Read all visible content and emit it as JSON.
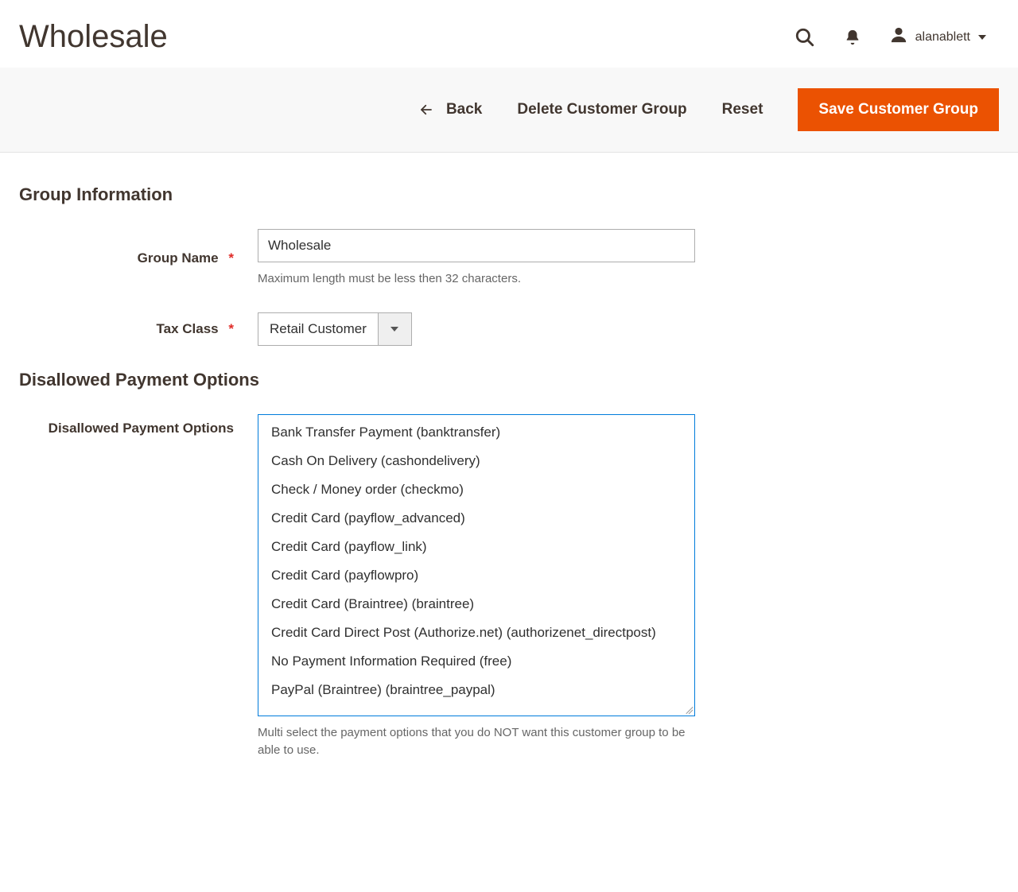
{
  "header": {
    "title": "Wholesale",
    "username": "alanablett"
  },
  "toolbar": {
    "back_label": "Back",
    "delete_label": "Delete Customer Group",
    "reset_label": "Reset",
    "save_label": "Save Customer Group"
  },
  "fieldsets": {
    "group_info": {
      "legend": "Group Information",
      "group_name": {
        "label": "Group Name",
        "value": "Wholesale",
        "note": "Maximum length must be less then 32 characters."
      },
      "tax_class": {
        "label": "Tax Class",
        "value": "Retail Customer"
      }
    },
    "disallowed_payments": {
      "legend": "Disallowed Payment Options",
      "field_label": "Disallowed Payment Options",
      "options": [
        "Bank Transfer Payment (banktransfer)",
        "Cash On Delivery (cashondelivery)",
        "Check / Money order (checkmo)",
        "Credit Card (payflow_advanced)",
        "Credit Card (payflow_link)",
        "Credit Card (payflowpro)",
        "Credit Card (Braintree) (braintree)",
        "Credit Card Direct Post (Authorize.net) (authorizenet_directpost)",
        "No Payment Information Required (free)",
        "PayPal (Braintree) (braintree_paypal)"
      ],
      "note": "Multi select the payment options that you do NOT want this customer group to be able to use."
    }
  }
}
